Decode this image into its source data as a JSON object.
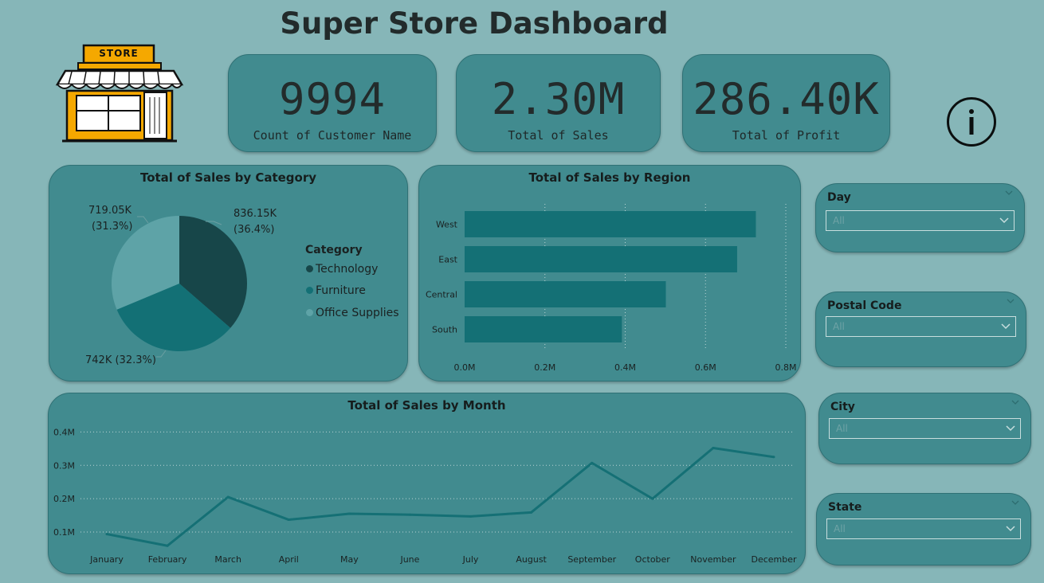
{
  "header": {
    "title": "Super Store Dashboard",
    "store_sign": "STORE"
  },
  "kpis": [
    {
      "value": "9994",
      "label": "Count of Customer Name"
    },
    {
      "value": "2.30M",
      "label": "Total of Sales"
    },
    {
      "value": "286.40K",
      "label": "Total of Profit"
    }
  ],
  "info_icon": "info-circle-icon",
  "colors": {
    "background": "#86b6b8",
    "card": "#418b8f",
    "technology": "#174649",
    "furniture": "#137075",
    "office_supplies": "#5ea3a7",
    "bar": "#147075",
    "line": "#157075"
  },
  "category_chart": {
    "title": "Total of Sales by Category",
    "legend_title": "Category"
  },
  "region_chart": {
    "title": "Total of Sales by Region"
  },
  "month_chart": {
    "title": "Total of Sales by Month"
  },
  "slicers": [
    {
      "label": "Day",
      "value": "All"
    },
    {
      "label": "Postal Code",
      "value": "All"
    },
    {
      "label": "City",
      "value": "All"
    },
    {
      "label": "State",
      "value": "All"
    }
  ],
  "chart_data": [
    {
      "type": "pie",
      "title": "Total of Sales by Category",
      "legend_title": "Category",
      "categories": [
        "Technology",
        "Furniture",
        "Office Supplies"
      ],
      "values": [
        836154.03,
        742000.0,
        719047.03
      ],
      "labels": [
        [
          "836.15K",
          "(36.4%)"
        ],
        [
          "742K (32.3%)"
        ],
        [
          "719.05K",
          "(31.3%)"
        ]
      ],
      "legend_position": "right"
    },
    {
      "type": "bar",
      "orientation": "horizontal",
      "title": "Total of Sales by Region",
      "categories": [
        "West",
        "East",
        "Central",
        "South"
      ],
      "values": [
        725458,
        678781,
        501240,
        391722
      ],
      "xlim": [
        0,
        0.8
      ],
      "xticks": [
        "0.0M",
        "0.2M",
        "0.4M",
        "0.6M",
        "0.8M"
      ],
      "grid": true
    },
    {
      "type": "line",
      "title": "Total of Sales by Month",
      "categories": [
        "January",
        "February",
        "March",
        "April",
        "May",
        "June",
        "July",
        "August",
        "September",
        "October",
        "November",
        "December"
      ],
      "values": [
        0.094,
        0.059,
        0.205,
        0.137,
        0.155,
        0.152,
        0.147,
        0.159,
        0.307,
        0.2,
        0.352,
        0.325
      ],
      "ylim": [
        0.05,
        0.42
      ],
      "yticks": [
        "0.1M",
        "0.2M",
        "0.3M",
        "0.4M"
      ],
      "grid": true
    }
  ]
}
